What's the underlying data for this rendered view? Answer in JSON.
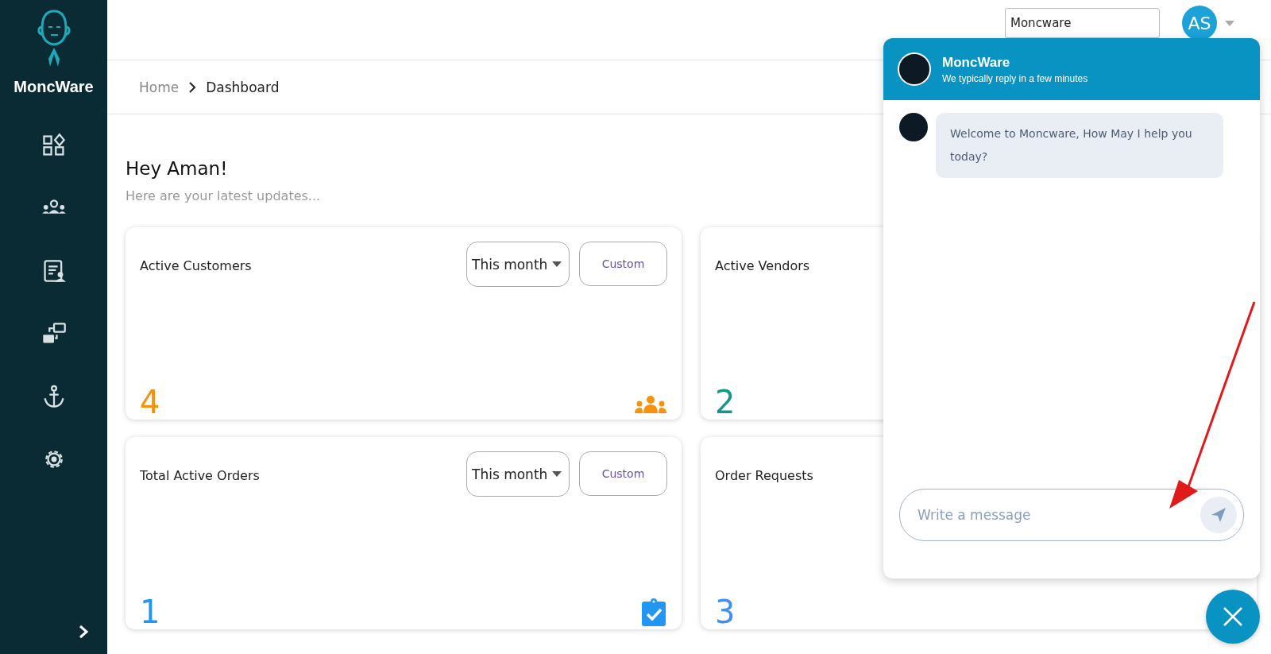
{
  "sidebar": {
    "brand": "MoncWare",
    "nav": [
      {
        "kind": "dashboard"
      },
      {
        "kind": "team"
      },
      {
        "kind": "report"
      },
      {
        "kind": "transfer"
      },
      {
        "kind": "anchor"
      },
      {
        "kind": "settings"
      }
    ]
  },
  "topbar": {
    "company_field": "Moncware",
    "avatar": "AS"
  },
  "breadcrumb": [
    {
      "label": "Home",
      "current": false
    },
    {
      "label": "Dashboard",
      "current": true
    }
  ],
  "greeting": {
    "title": "Hey Aman!",
    "subtitle": "Here are your latest updates..."
  },
  "cards": [
    {
      "title": "Active Customers",
      "period": "This month",
      "custom": "Custom",
      "value": "4",
      "color": "#f7920b",
      "kind": "people"
    },
    {
      "title": "Active Vendors",
      "value": "2",
      "color": "#16958a"
    },
    {
      "title": "Total Active Orders",
      "period": "This month",
      "custom": "Custom",
      "value": "1",
      "color": "#2196f3",
      "kind": "orders"
    },
    {
      "title": "Order Requests",
      "value": "3",
      "color": "#3f8ef0"
    }
  ],
  "chat": {
    "name": "MoncWare",
    "status": "We typically reply in a few minutes",
    "messages": [
      {
        "text": "Welcome to Moncware, How May I help you today?"
      }
    ],
    "placeholder": "Write a message"
  }
}
